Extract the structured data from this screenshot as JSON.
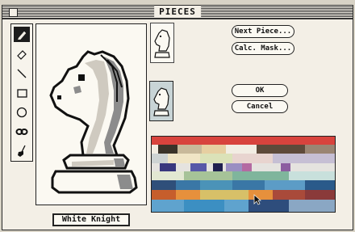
{
  "window": {
    "title": "PIECES"
  },
  "tools": [
    {
      "name": "pencil",
      "selected": true
    },
    {
      "name": "eraser",
      "selected": false
    },
    {
      "name": "line",
      "selected": false
    },
    {
      "name": "rectangle",
      "selected": false
    },
    {
      "name": "oval",
      "selected": false
    },
    {
      "name": "mirror",
      "selected": false
    },
    {
      "name": "fill",
      "selected": false
    }
  ],
  "piece": {
    "name": "White Knight"
  },
  "buttons": {
    "next_piece": "Next Piece...",
    "calc_mask": "Calc. Mask...",
    "ok": "OK",
    "cancel": "Cancel"
  },
  "colors": {
    "palette_top": "#d8433d",
    "selected_thumb_bg": "#c8d4d6",
    "window_bg": "#f3efe6"
  }
}
